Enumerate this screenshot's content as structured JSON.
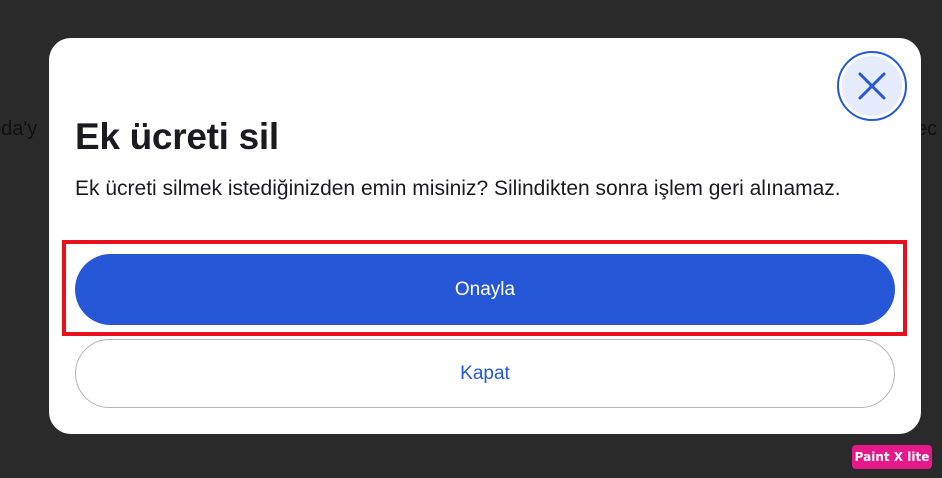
{
  "background": {
    "left_fragment": "oda'y",
    "right_fragment": "ec"
  },
  "dialog": {
    "title": "Ek ücreti sil",
    "message": "Ek ücreti silmek istediğinizden emin misiniz? Silindikten sonra işlem geri alınamaz.",
    "confirm_label": "Onayla",
    "close_label": "Kapat",
    "close_icon": "close-icon"
  },
  "watermark": {
    "label": "Paint X lite"
  },
  "colors": {
    "primary": "#2557d6",
    "highlight": "#e8101e",
    "watermark": "#e5198a"
  }
}
